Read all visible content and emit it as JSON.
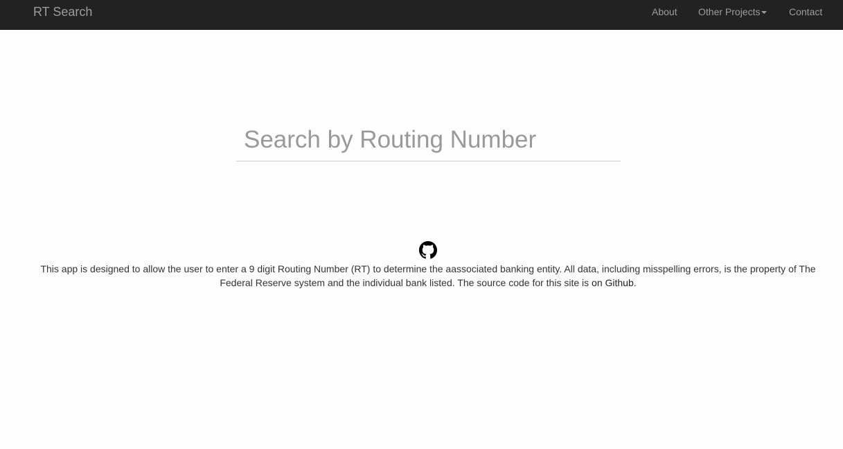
{
  "navbar": {
    "brand": "RT Search",
    "items": [
      {
        "label": "About"
      },
      {
        "label": "Other Projects"
      },
      {
        "label": "Contact"
      }
    ],
    "bg_color": "#222222",
    "text_color": "#9d9d9d"
  },
  "search": {
    "placeholder": "Search by Routing Number",
    "value": ""
  },
  "footer": {
    "icon": "github-icon",
    "text": "This app is designed to allow the user to enter a 9 digit Routing Number (RT) to determine the aassociated banking entity. All data, including misspelling errors, is the property of The Federal Reserve system and the individual bank listed. The source code for this site is ",
    "link_label": "on Github",
    "suffix": "."
  }
}
